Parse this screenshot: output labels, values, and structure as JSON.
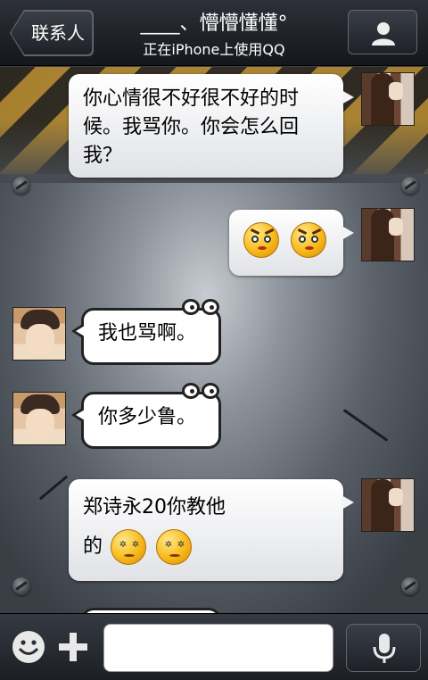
{
  "header": {
    "back_label": "联系人",
    "title": "____、懵懵懂懂°",
    "subtitle": "正在iPhone上使用QQ",
    "profile_icon": "person-icon"
  },
  "messages": [
    {
      "sender": "self",
      "text": "你心情很不好很不好的时候。我骂你。你会怎么回我？"
    },
    {
      "sender": "self",
      "text": "",
      "emojis": [
        "angry-face-icon",
        "angry-face-icon"
      ]
    },
    {
      "sender": "other",
      "text": "我也骂啊。"
    },
    {
      "sender": "other",
      "text": "你多少鲁。"
    },
    {
      "sender": "self",
      "text": "郑诗永20你教他",
      "text2": "的",
      "emojis": [
        "dizzy-face-icon",
        "dizzy-face-icon"
      ]
    }
  ],
  "inputbar": {
    "emoji_icon": "smiley-icon",
    "plus_icon": "plus-icon",
    "input_value": "",
    "input_placeholder": "",
    "voice_icon": "microphone-icon"
  },
  "colors": {
    "header_bg": "#1c1f24",
    "bubble_self": "#ffffff",
    "bubble_other_border": "#222222",
    "hazard_yellow": "#b88a2a"
  }
}
